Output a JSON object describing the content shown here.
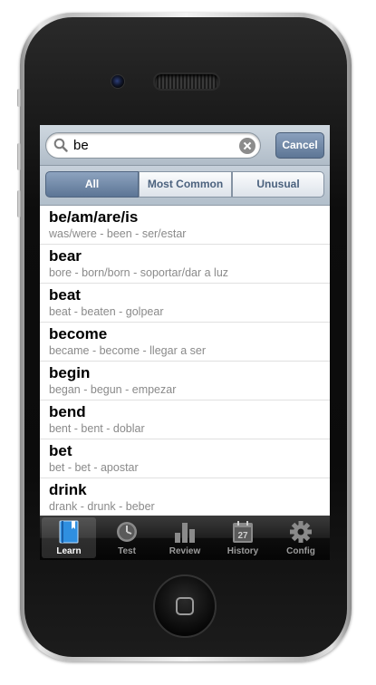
{
  "search": {
    "query": "be",
    "cancel_label": "Cancel"
  },
  "segments": [
    {
      "label": "All",
      "selected": true
    },
    {
      "label": "Most Common",
      "selected": false
    },
    {
      "label": "Unusual",
      "selected": false
    }
  ],
  "verbs": [
    {
      "word": "be/am/are/is",
      "forms": "was/were - been - ser/estar"
    },
    {
      "word": "bear",
      "forms": "bore - born/born - soportar/dar a luz"
    },
    {
      "word": "beat",
      "forms": "beat - beaten - golpear"
    },
    {
      "word": "become",
      "forms": "became - become - llegar a ser"
    },
    {
      "word": "begin",
      "forms": "began - begun - empezar"
    },
    {
      "word": "bend",
      "forms": "bent - bent - doblar"
    },
    {
      "word": "bet",
      "forms": "bet - bet - apostar"
    },
    {
      "word": "drink",
      "forms": "drank - drunk - beber"
    }
  ],
  "tabs": [
    {
      "label": "Learn",
      "icon": "book-icon",
      "active": true
    },
    {
      "label": "Test",
      "icon": "clock-icon",
      "active": false
    },
    {
      "label": "Review",
      "icon": "bar-chart-icon",
      "active": false
    },
    {
      "label": "History",
      "icon": "calendar-icon",
      "active": false,
      "calendar_day": "27"
    },
    {
      "label": "Config",
      "icon": "gear-icon",
      "active": false
    }
  ],
  "colors": {
    "accent": "#5d7695",
    "tab_active_icon": "#2f8fe0"
  }
}
